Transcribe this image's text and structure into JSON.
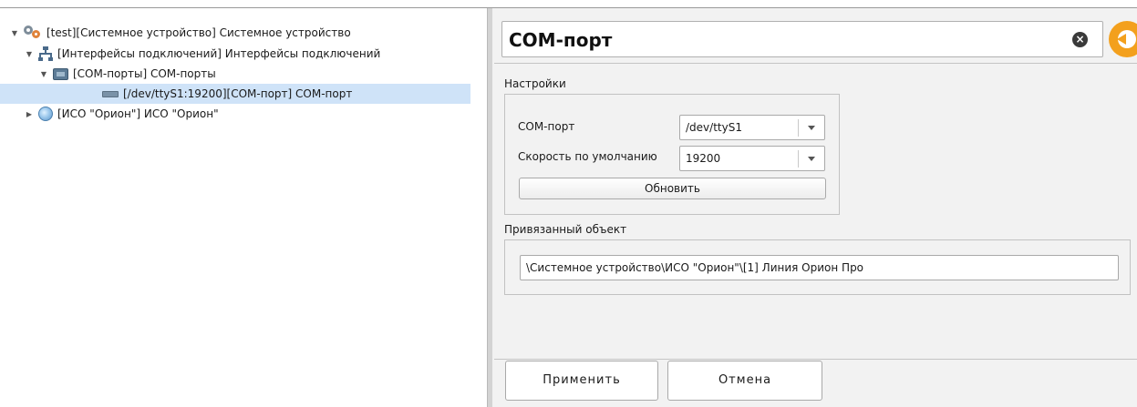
{
  "tree": {
    "items": [
      {
        "label": "[test][Системное устройство] Системное устройство",
        "expander": "▼",
        "icon": "gear-icon",
        "level": 0
      },
      {
        "label": "[Интерфейсы подключений] Интерфейсы подключений",
        "expander": "▼",
        "icon": "network-icon",
        "level": 1
      },
      {
        "label": "[COM-порты] COM-порты",
        "expander": "▼",
        "icon": "com-ports-icon",
        "level": 2
      },
      {
        "label": "[/dev/ttyS1:19200][COM-порт] COM-порт",
        "expander": "",
        "icon": "com-port-icon",
        "level": 3,
        "selected": true
      },
      {
        "label": "[ИСО \"Орион\"] ИСО \"Орион\"",
        "expander": "▶",
        "icon": "orion-icon",
        "level": 0
      }
    ]
  },
  "detail": {
    "title": "COM-порт",
    "clear_icon": "×",
    "settings": {
      "group_label": "Настройки",
      "com_port_label": "COM-порт",
      "com_port_value": "/dev/ttyS1",
      "speed_label": "Скорость по умолчанию",
      "speed_value": "19200",
      "refresh_label": "Обновить"
    },
    "linked": {
      "group_label": "Привязанный объект",
      "value": "\\Системное устройство\\ИСО \"Орион\"\\[1] Линия Орион Про"
    },
    "apply_label": "Применить",
    "cancel_label": "Отмена"
  },
  "colors": {
    "selection": "#cfe3f8",
    "accent_back": "#f3a01d",
    "panel_bg": "#f2f2f2"
  }
}
